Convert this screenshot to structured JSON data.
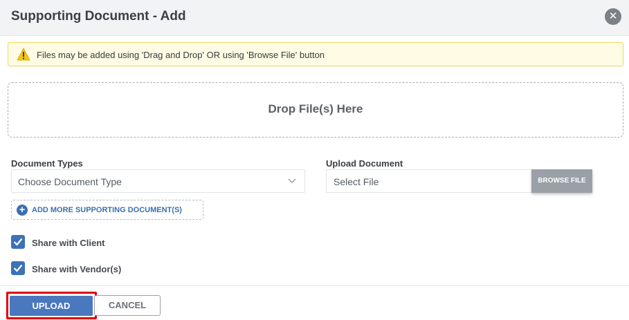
{
  "dialog": {
    "title": "Supporting Document - Add",
    "close_symbol": "✕"
  },
  "alert": {
    "icon": "warning-icon",
    "text": "Files may be added using 'Drag and Drop' OR using 'Browse File' button"
  },
  "dropzone": {
    "text": "Drop File(s) Here"
  },
  "form": {
    "document_types_label": "Document Types",
    "document_type_value": "Choose Document Type",
    "upload_document_label": "Upload Document",
    "upload_document_value": "Select File",
    "browse_label": "BROWSE FILE",
    "add_more_label": "ADD MORE SUPPORTING DOCUMENT(S)",
    "add_more_symbol": "+",
    "share_client_label": "Share with Client",
    "share_client_checked": true,
    "share_vendor_label": "Share with Vendor(s)",
    "share_vendor_checked": true
  },
  "footer": {
    "upload_label": "UPLOAD",
    "cancel_label": "CANCEL"
  },
  "colors": {
    "accent": "#4a78bf",
    "checkbox": "#3d72b8",
    "warning": "#f3c515",
    "highlight": "#e00000"
  }
}
